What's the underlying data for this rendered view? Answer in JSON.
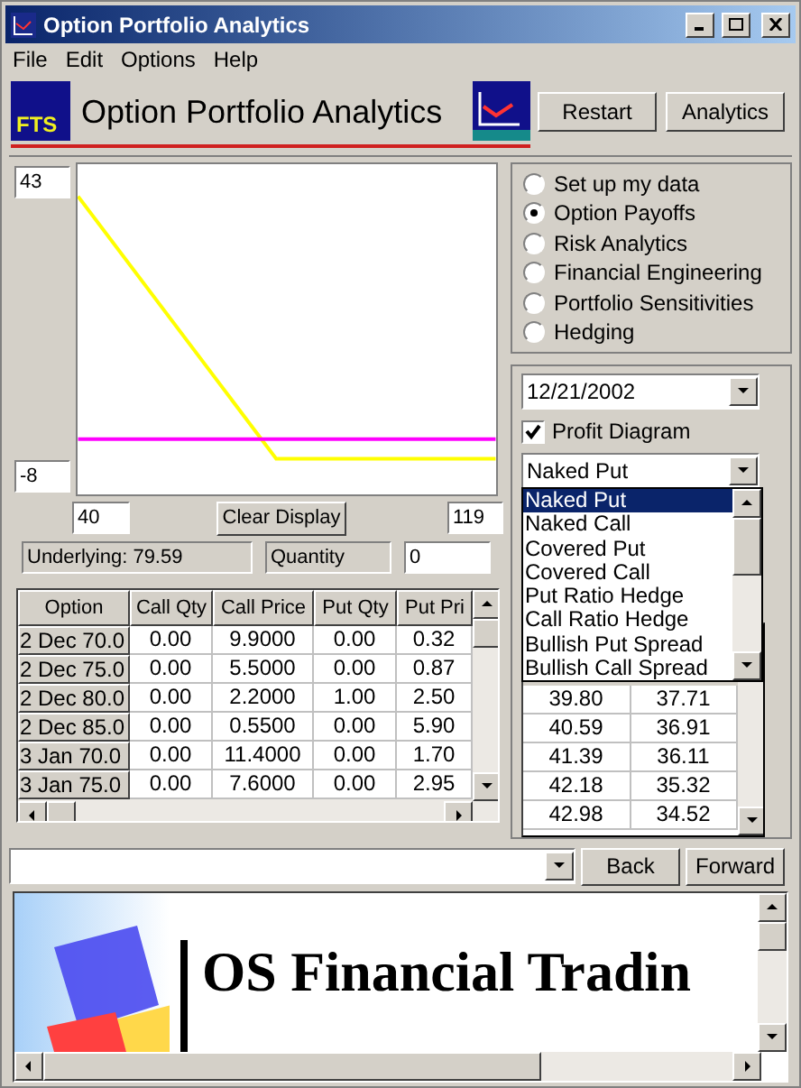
{
  "window": {
    "title": "Option Portfolio Analytics"
  },
  "menu": [
    "File",
    "Edit",
    "Options",
    "Help"
  ],
  "header": {
    "logo": "FTS",
    "title": "Option Portfolio Analytics",
    "buttons": [
      "Restart",
      "Analytics"
    ]
  },
  "payoff": {
    "y_max": "43",
    "y_min": "-8",
    "x_min": "40",
    "x_max": "119",
    "clear_button": "Clear Display",
    "underlying": "Underlying: 79.59",
    "quantity_label": "Quantity",
    "quantity": "0"
  },
  "options_table": {
    "columns": [
      "Option",
      "Call Qty",
      "Call Price",
      "Put Qty",
      "Put Pri"
    ],
    "rows": [
      [
        "2 Dec 70.0",
        "0.00",
        "9.9000",
        "0.00",
        "0.32"
      ],
      [
        "2 Dec 75.0",
        "0.00",
        "5.5000",
        "0.00",
        "0.87"
      ],
      [
        "2 Dec 80.0",
        "0.00",
        "2.2000",
        "1.00",
        "2.50"
      ],
      [
        "2 Dec 85.0",
        "0.00",
        "0.5500",
        "0.00",
        "5.90"
      ],
      [
        "3 Jan 70.0",
        "0.00",
        "11.4000",
        "0.00",
        "1.70"
      ],
      [
        "3 Jan 75.0",
        "0.00",
        "7.6000",
        "0.00",
        "2.95"
      ]
    ]
  },
  "modes": [
    {
      "label": "Set up my data",
      "selected": false
    },
    {
      "label": "Option Payoffs",
      "selected": true
    },
    {
      "label": "Risk Analytics",
      "selected": false
    },
    {
      "label": "Financial Engineering",
      "selected": false
    },
    {
      "label": "Portfolio Sensitivities",
      "selected": false
    },
    {
      "label": "Hedging",
      "selected": false
    }
  ],
  "date": "12/21/2002",
  "profit_diagram": {
    "label": "Profit Diagram",
    "checked": true
  },
  "strategy": {
    "value": "Naked Put",
    "expanded": true,
    "options": [
      {
        "label": "Naked Put",
        "selected": true
      },
      {
        "label": "Naked Call",
        "selected": false
      },
      {
        "label": "Covered Put",
        "selected": false
      },
      {
        "label": "Covered Call",
        "selected": false
      },
      {
        "label": "Put Ratio Hedge",
        "selected": false
      },
      {
        "label": "Call Ratio Hedge",
        "selected": false
      },
      {
        "label": "Bullish Put Spread",
        "selected": false
      },
      {
        "label": "Bullish Call Spread",
        "selected": false
      }
    ]
  },
  "results_table": {
    "rows": [
      [
        "39.80",
        "37.71"
      ],
      [
        "40.59",
        "36.91"
      ],
      [
        "41.39",
        "36.11"
      ],
      [
        "42.18",
        "35.32"
      ],
      [
        "42.98",
        "34.52"
      ]
    ]
  },
  "nav": {
    "buttons": [
      "Back",
      "Forward"
    ]
  },
  "browser": {
    "heading": "OS Financial Tradin"
  }
}
